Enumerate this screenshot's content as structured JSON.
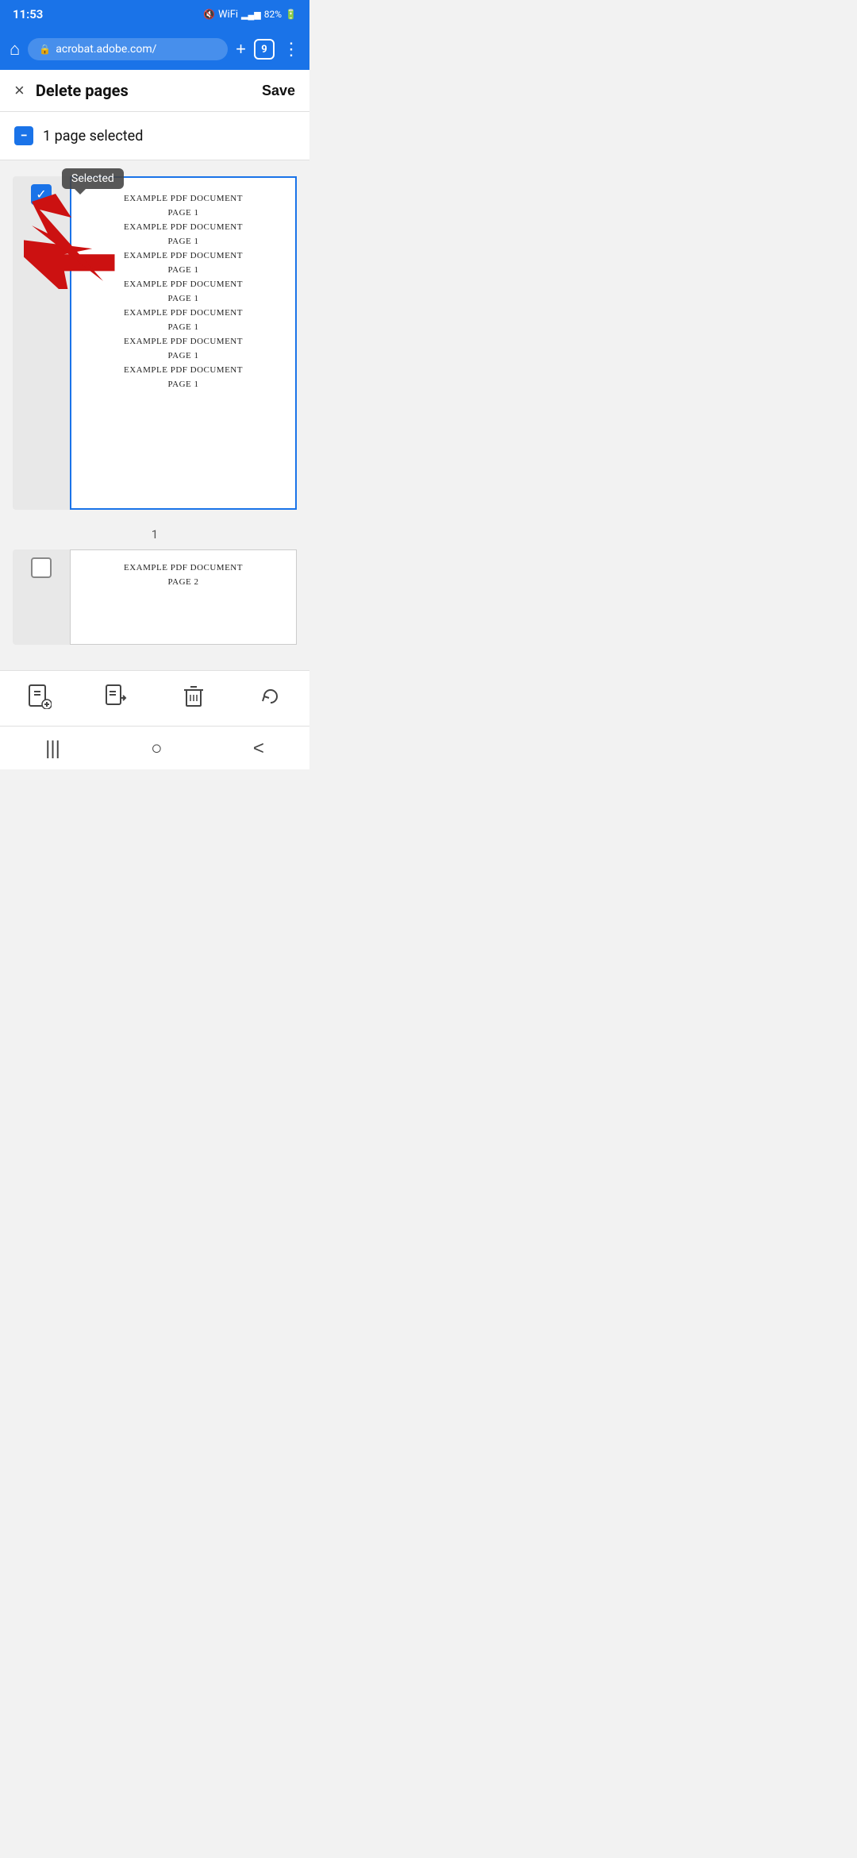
{
  "statusBar": {
    "time": "11:53",
    "batteryPercent": "82%"
  },
  "browserBar": {
    "url": "acrobat.adobe.com/",
    "tabsCount": "9"
  },
  "header": {
    "title": "Delete pages",
    "saveLabel": "Save",
    "closeLabel": "×"
  },
  "selectionBar": {
    "text": "1 page selected"
  },
  "tooltip": {
    "text": "Selected"
  },
  "page1": {
    "pageNumber": "1",
    "pdfLines": [
      "EXAMPLE PDF DOCUMENT",
      "PAGE 1",
      "EXAMPLE PDF DOCUMENT",
      "PAGE 1",
      "EXAMPLE PDF DOCUMENT",
      "PAGE 1",
      "EXAMPLE PDF DOCUMENT",
      "PAGE 1",
      "EXAMPLE PDF DOCUMENT",
      "PAGE 1",
      "EXAMPLE PDF DOCUMENT",
      "PAGE 1",
      "EXAMPLE PDF DOCUMENT",
      "PAGE 1"
    ]
  },
  "page2": {
    "pdfLines": [
      "EXAMPLE PDF DOCUMENT",
      "PAGE 2"
    ]
  },
  "toolbar": {
    "addPage": "add-page",
    "exportPage": "export-page",
    "deletePage": "delete-page",
    "rotatePage": "rotate-page"
  },
  "navBar": {
    "recentApps": "|||",
    "home": "○",
    "back": "<"
  }
}
